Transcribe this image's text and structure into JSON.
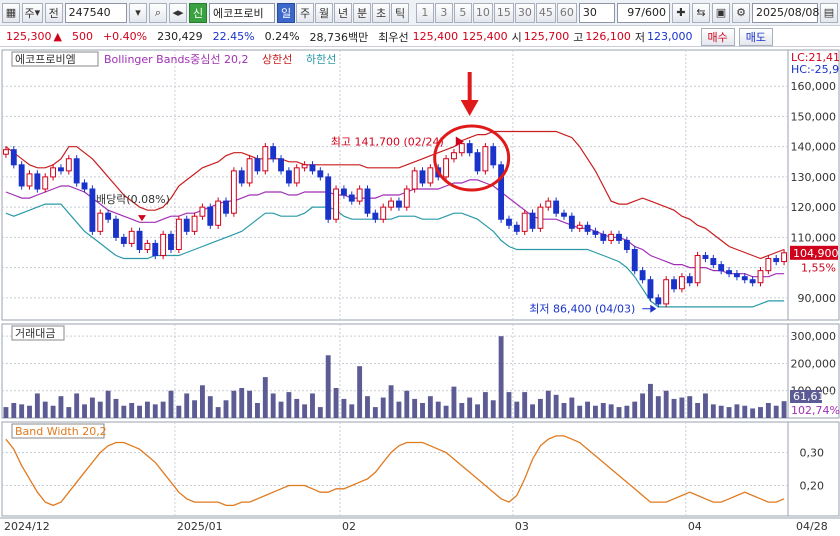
{
  "toolbar": {
    "market": "주",
    "type": "전",
    "code": "247540",
    "badge": "신",
    "stock_name": "에코프로비",
    "periods": [
      "일",
      "주",
      "월",
      "년",
      "분",
      "초",
      "틱"
    ],
    "active_period": "일",
    "minutes": [
      "1",
      "3",
      "5",
      "10",
      "15",
      "30",
      "45",
      "60"
    ],
    "count": "30",
    "paging": "97/600",
    "date": "2025/08/08"
  },
  "info": {
    "price": "125,300",
    "change_arrow": "▲",
    "change": "500",
    "change_pct": "+0.40%",
    "volume": "230,429",
    "turnover_pct": "22.45%",
    "ratio_pct": "0.24%",
    "amount": "28,736백만",
    "pref_label": "최우선",
    "ask": "125,400",
    "bid": "125,400",
    "open_label": "시",
    "open": "125,700",
    "high_label": "고",
    "high": "126,100",
    "low_label": "저",
    "low": "123,000",
    "buy_label": "매수",
    "sell_label": "매도"
  },
  "colors": {
    "up": "#d0021b",
    "down": "#1a33c9",
    "upper_band": "#c81e1e",
    "middle_band": "#a12fb5",
    "lower_band": "#2a9aa8",
    "volume": "#5c5b94",
    "bandwidth": "#e07a1f",
    "annotation_circle": "#e01a1a"
  },
  "chart_data": [
    {
      "type": "line",
      "title": "에코프로비엠",
      "legend": [
        "Bollinger Bands중심선 20,2",
        "상한선",
        "하한선"
      ],
      "x_ticks": [
        "2024/12",
        "2025/01",
        "02",
        "03",
        "04",
        "04/28"
      ],
      "y_ticks": [
        90000,
        100000,
        110000,
        120000,
        130000,
        140000,
        150000,
        160000
      ],
      "y_tick_labels": [
        "90,000",
        "1,55%",
        "110,000",
        "120,000",
        "130,000",
        "140,000",
        "150,000",
        "160,000"
      ],
      "ylim": [
        84000,
        168000
      ],
      "right_labels": [
        "LC:21,41",
        "HC:-25,9"
      ],
      "current_price_label": "104,900",
      "close": [
        139000,
        134000,
        127000,
        131000,
        126000,
        130000,
        133000,
        132000,
        136000,
        128000,
        126000,
        112000,
        118000,
        116000,
        110000,
        108000,
        112000,
        106000,
        108000,
        104000,
        111000,
        106000,
        116000,
        112000,
        117000,
        120000,
        114000,
        122000,
        118000,
        132000,
        128000,
        136000,
        132000,
        140000,
        136000,
        132000,
        128000,
        133000,
        134000,
        132000,
        130000,
        116000,
        126000,
        124000,
        122000,
        126000,
        118000,
        116000,
        120000,
        122000,
        120000,
        126000,
        132000,
        128000,
        133000,
        130000,
        136000,
        138000,
        141000,
        138000,
        132000,
        140000,
        134000,
        116000,
        114000,
        112000,
        118000,
        113000,
        120000,
        122000,
        118000,
        117000,
        113000,
        114000,
        112000,
        111000,
        109000,
        111000,
        109000,
        106000,
        99000,
        96000,
        90000,
        88000,
        96000,
        93000,
        97000,
        95000,
        104000,
        103000,
        101000,
        99000,
        98000,
        97000,
        96000,
        95000,
        99000,
        103000,
        102000,
        104900
      ],
      "upper": [
        140000,
        138000,
        136000,
        134000,
        133000,
        133000,
        134000,
        136000,
        140000,
        140000,
        138000,
        136000,
        133000,
        130000,
        127000,
        124000,
        122000,
        120000,
        119000,
        119000,
        120000,
        123000,
        127000,
        129000,
        131000,
        133000,
        134000,
        135000,
        137000,
        138000,
        138000,
        137000,
        136000,
        136000,
        136000,
        136000,
        135000,
        135000,
        134000,
        134000,
        134000,
        134000,
        134000,
        134000,
        134000,
        134000,
        133000,
        133000,
        133000,
        133000,
        133000,
        134000,
        135000,
        136000,
        137000,
        138000,
        139000,
        140000,
        142000,
        143000,
        144000,
        144000,
        145000,
        145000,
        145000,
        145000,
        145000,
        145000,
        145000,
        145000,
        145000,
        144000,
        143000,
        140000,
        136000,
        132000,
        127000,
        122000,
        121000,
        121000,
        122000,
        123000,
        122000,
        121000,
        120000,
        119000,
        117000,
        116000,
        114000,
        113000,
        111000,
        109000,
        107000,
        106000,
        105000,
        104000,
        103000,
        104000,
        105000,
        106000
      ],
      "middle": [
        125000,
        124000,
        123000,
        123000,
        124000,
        125000,
        126000,
        127000,
        127000,
        126000,
        125000,
        123000,
        121000,
        119000,
        118000,
        117000,
        116000,
        115000,
        115000,
        115000,
        116000,
        117000,
        117000,
        118000,
        118000,
        119000,
        120000,
        121000,
        122000,
        122000,
        123000,
        124000,
        124000,
        125000,
        125000,
        125000,
        124000,
        124000,
        125000,
        125000,
        125000,
        125000,
        124000,
        124000,
        123000,
        123000,
        123000,
        123000,
        124000,
        124000,
        124000,
        125000,
        126000,
        126000,
        126000,
        126000,
        127000,
        128000,
        128000,
        129000,
        129000,
        128000,
        127000,
        125000,
        123000,
        121000,
        119000,
        117000,
        116000,
        116000,
        116000,
        115000,
        114000,
        113000,
        113000,
        112000,
        111000,
        110000,
        110000,
        109000,
        107000,
        106000,
        104000,
        103000,
        102000,
        101000,
        101000,
        100000,
        100000,
        100000,
        99000,
        99000,
        98000,
        98000,
        98000,
        97000,
        97000,
        97000,
        98000,
        98000
      ],
      "lower": [
        118000,
        117000,
        118000,
        119000,
        120000,
        121000,
        121000,
        121000,
        118000,
        115000,
        112000,
        110000,
        108000,
        106000,
        104000,
        103000,
        103000,
        103000,
        103000,
        104000,
        104000,
        104000,
        104000,
        105000,
        106000,
        107000,
        108000,
        109000,
        110000,
        111000,
        112000,
        114000,
        116000,
        118000,
        118000,
        117000,
        117000,
        117000,
        118000,
        120000,
        120000,
        120000,
        119000,
        117000,
        116000,
        116000,
        116000,
        116000,
        116000,
        116000,
        117000,
        117000,
        117000,
        116000,
        116000,
        116000,
        117000,
        118000,
        118000,
        117000,
        116000,
        114000,
        112000,
        109000,
        107000,
        106000,
        106000,
        106000,
        106000,
        106000,
        106000,
        106000,
        106000,
        106000,
        106000,
        105000,
        104000,
        103000,
        102000,
        100000,
        97000,
        93000,
        89000,
        87000,
        87000,
        87000,
        87000,
        87000,
        87000,
        87000,
        87000,
        87000,
        87000,
        87000,
        87000,
        87000,
        88000,
        89000,
        89000,
        89000
      ],
      "annotations": [
        {
          "text": "최고 141,700 (02/24)",
          "value": 141700,
          "index": 58
        },
        {
          "text": "최저 86,400 (04/03)",
          "value": 86400,
          "index": 83
        },
        {
          "text": "배당락(0.08%)",
          "value": 120000,
          "index": 14
        }
      ]
    },
    {
      "type": "bar",
      "title": "거래대금",
      "y_tick_labels": [
        "100,000",
        "200,000",
        "300,000"
      ],
      "ylim": [
        0,
        330000
      ],
      "current_label": "61,617",
      "right_label": "102,74%",
      "values": [
        40000,
        55000,
        50000,
        45000,
        90000,
        60000,
        45000,
        80000,
        40000,
        90000,
        50000,
        75000,
        60000,
        100000,
        70000,
        45000,
        55000,
        45000,
        60000,
        50000,
        60000,
        100000,
        45000,
        90000,
        65000,
        120000,
        80000,
        40000,
        65000,
        100000,
        110000,
        100000,
        55000,
        150000,
        90000,
        60000,
        95000,
        70000,
        50000,
        90000,
        40000,
        230000,
        110000,
        70000,
        50000,
        190000,
        80000,
        40000,
        75000,
        120000,
        60000,
        100000,
        70000,
        55000,
        80000,
        60000,
        45000,
        115000,
        55000,
        75000,
        50000,
        95000,
        65000,
        300000,
        95000,
        60000,
        95000,
        50000,
        70000,
        100000,
        85000,
        55000,
        75000,
        45000,
        60000,
        45000,
        55000,
        50000,
        40000,
        45000,
        60000,
        90000,
        125000,
        80000,
        100000,
        70000,
        75000,
        80000,
        55000,
        90000,
        50000,
        45000,
        40000,
        50000,
        45000,
        35000,
        40000,
        55000,
        45000,
        61617
      ]
    },
    {
      "type": "line",
      "title": "Band Width 20,2",
      "y_tick_labels": [
        "0,20",
        "0,30"
      ],
      "ylim": [
        0.12,
        0.38
      ],
      "values": [
        0.34,
        0.31,
        0.26,
        0.22,
        0.18,
        0.15,
        0.14,
        0.15,
        0.18,
        0.21,
        0.24,
        0.27,
        0.3,
        0.32,
        0.33,
        0.33,
        0.32,
        0.31,
        0.29,
        0.27,
        0.24,
        0.21,
        0.18,
        0.16,
        0.15,
        0.15,
        0.15,
        0.15,
        0.14,
        0.14,
        0.15,
        0.15,
        0.16,
        0.17,
        0.18,
        0.19,
        0.2,
        0.2,
        0.2,
        0.19,
        0.18,
        0.18,
        0.19,
        0.19,
        0.2,
        0.21,
        0.22,
        0.24,
        0.27,
        0.3,
        0.32,
        0.33,
        0.33,
        0.33,
        0.32,
        0.31,
        0.3,
        0.28,
        0.26,
        0.24,
        0.22,
        0.2,
        0.18,
        0.16,
        0.15,
        0.17,
        0.22,
        0.28,
        0.32,
        0.34,
        0.35,
        0.35,
        0.34,
        0.33,
        0.31,
        0.29,
        0.27,
        0.25,
        0.23,
        0.21,
        0.19,
        0.17,
        0.15,
        0.15,
        0.15,
        0.16,
        0.17,
        0.18,
        0.17,
        0.16,
        0.15,
        0.15,
        0.16,
        0.17,
        0.18,
        0.17,
        0.16,
        0.15,
        0.15,
        0.16
      ]
    }
  ]
}
